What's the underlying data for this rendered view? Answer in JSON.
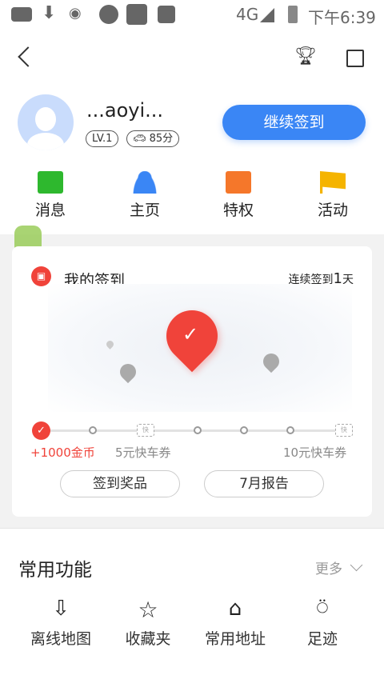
{
  "status_bar": {
    "network": "4G",
    "time": "下午6:39"
  },
  "profile": {
    "name": "...aoyi...",
    "level": "LV.1",
    "score": "85分",
    "checkin_button": "继续签到"
  },
  "quick_nav": [
    {
      "label": "消息",
      "color": "#2eb82e"
    },
    {
      "label": "主页",
      "color": "#3a86f5"
    },
    {
      "label": "特权",
      "color": "#f5772a"
    },
    {
      "label": "活动",
      "color": "#f5b400"
    }
  ],
  "checkin": {
    "title": "我的签到",
    "streak_prefix": "连续签到",
    "streak_days": "1",
    "streak_suffix": "天",
    "reward_1": "+1000金币",
    "reward_2": "5元快车券",
    "reward_3": "10元快车券",
    "ticket_glyph": "快",
    "prizes_button": "签到奖品",
    "report_button": "7月报告",
    "days_checked": 1,
    "days_total": 7,
    "accent": "#f0433a"
  },
  "features": {
    "title": "常用功能",
    "more": "更多",
    "items": [
      {
        "label": "离线地图",
        "icon": "download-map-icon"
      },
      {
        "label": "收藏夹",
        "icon": "star-icon"
      },
      {
        "label": "常用地址",
        "icon": "home-star-icon"
      },
      {
        "label": "足迹",
        "icon": "footprint-icon"
      }
    ]
  }
}
